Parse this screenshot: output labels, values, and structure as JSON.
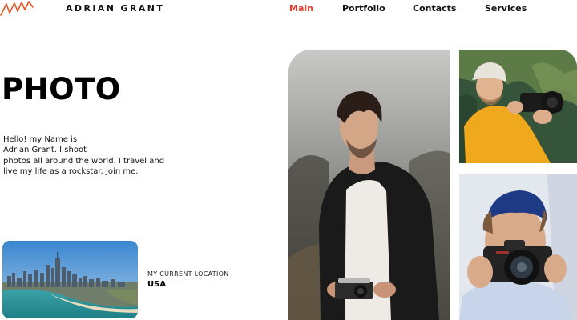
{
  "brand": {
    "name": "ADRIAN GRANT",
    "logo_icon": "signature-logo-icon",
    "logo_color": "#e8531f"
  },
  "nav": {
    "items": [
      "Main",
      "Portfolio",
      "Contacts",
      "Services"
    ],
    "active": "Main",
    "active_color": "#e23b2e"
  },
  "hero": {
    "title": "PHOTO",
    "lines": [
      "Hello! my Name is",
      "Adrian Grant. I shoot",
      "photos all around the world. I travel and",
      "live my life as a rockstar. Join me."
    ]
  },
  "location": {
    "label": "MY CURRENT LOCATION",
    "value": "USA"
  }
}
